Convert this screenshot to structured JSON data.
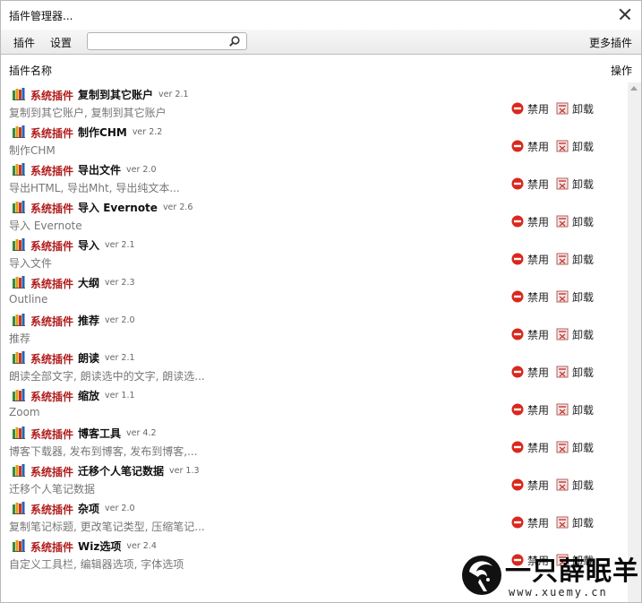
{
  "window": {
    "title": "插件管理器..."
  },
  "toolbar": {
    "menu_plugins": "插件",
    "menu_settings": "设置",
    "search_value": "",
    "more_plugins": "更多插件"
  },
  "header": {
    "name_col": "插件名称",
    "action_col": "操作"
  },
  "category_label": "系统插件",
  "actions": {
    "disable": "禁用",
    "uninstall": "卸载"
  },
  "plugins": [
    {
      "name": "复制到其它账户",
      "version": "ver 2.1",
      "description": "复制到其它账户, 复制到其它账户"
    },
    {
      "name": "制作CHM",
      "version": "ver 2.2",
      "description": "制作CHM"
    },
    {
      "name": "导出文件",
      "version": "ver 2.0",
      "description": "导出HTML, 导出Mht, 导出纯文本..."
    },
    {
      "name": "导入 Evernote",
      "version": "ver 2.6",
      "description": "导入 Evernote"
    },
    {
      "name": "导入",
      "version": "ver 2.1",
      "description": "导入文件"
    },
    {
      "name": "大纲",
      "version": "ver 2.3",
      "description": "Outline"
    },
    {
      "name": "推荐",
      "version": "ver 2.0",
      "description": "推荐"
    },
    {
      "name": "朗读",
      "version": "ver 2.1",
      "description": "朗读全部文字, 朗读选中的文字, 朗读选..."
    },
    {
      "name": "缩放",
      "version": "ver 1.1",
      "description": "Zoom"
    },
    {
      "name": "博客工具",
      "version": "ver 4.2",
      "description": "博客下载器, 发布到博客, 发布到博客,..."
    },
    {
      "name": "迁移个人笔记数据",
      "version": "ver 1.3",
      "description": "迁移个人笔记数据"
    },
    {
      "name": "杂项",
      "version": "ver 2.0",
      "description": "复制笔记标题, 更改笔记类型, 压缩笔记..."
    },
    {
      "name": "Wiz选项",
      "version": "ver 2.4",
      "description": "自定义工具栏, 编辑器选项, 字体选项"
    }
  ],
  "watermark": {
    "text": "一只薛眠羊",
    "url": "www.xuemy.cn"
  },
  "icons": {
    "plugin": "plugin-books-icon",
    "disable": "disable-red-circle-icon",
    "uninstall": "uninstall-icon",
    "search": "search-icon",
    "close": "close-icon"
  },
  "colors": {
    "category": "#b01c1c",
    "description": "#777777",
    "disable_icon": "#d9281d"
  }
}
